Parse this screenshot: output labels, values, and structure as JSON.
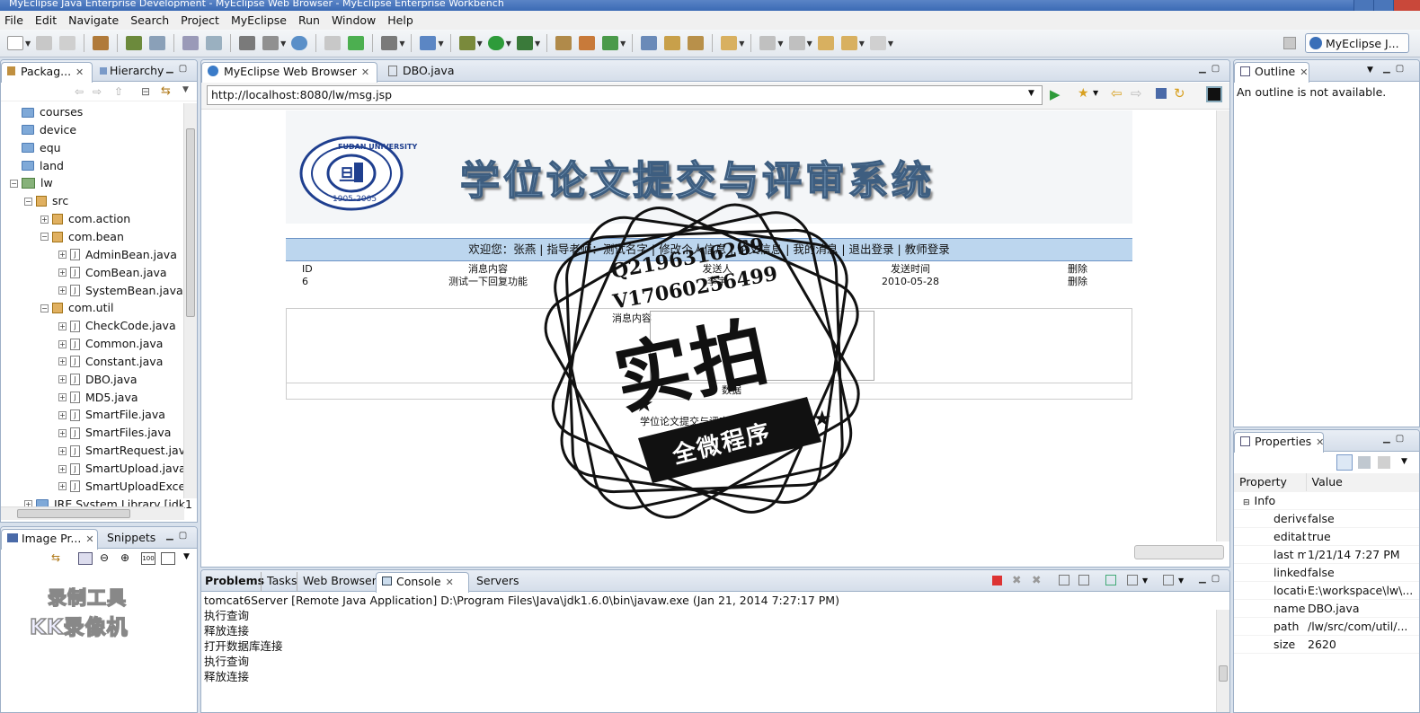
{
  "window": {
    "title": "MyEclipse Java Enterprise Development - MyEclipse Web Browser - MyEclipse Enterprise Workbench"
  },
  "menu": [
    "File",
    "Edit",
    "Navigate",
    "Search",
    "Project",
    "MyEclipse",
    "Run",
    "Window",
    "Help"
  ],
  "perspective": "MyEclipse J...",
  "explorer": {
    "tabs": [
      "Packag...",
      "Hierarchy"
    ],
    "items": [
      {
        "label": "courses",
        "type": "folder",
        "depth": 0
      },
      {
        "label": "device",
        "type": "folder",
        "depth": 0
      },
      {
        "label": "equ",
        "type": "folder",
        "depth": 0
      },
      {
        "label": "land",
        "type": "folder",
        "depth": 0
      },
      {
        "label": "lw",
        "type": "project",
        "depth": 0
      },
      {
        "label": "src",
        "type": "src",
        "depth": 1
      },
      {
        "label": "com.action",
        "type": "package",
        "depth": 2
      },
      {
        "label": "com.bean",
        "type": "package",
        "depth": 2
      },
      {
        "label": "AdminBean.java",
        "type": "java",
        "depth": 3
      },
      {
        "label": "ComBean.java",
        "type": "java",
        "depth": 3
      },
      {
        "label": "SystemBean.java",
        "type": "java",
        "depth": 3
      },
      {
        "label": "com.util",
        "type": "package",
        "depth": 2
      },
      {
        "label": "CheckCode.java",
        "type": "java",
        "depth": 3
      },
      {
        "label": "Common.java",
        "type": "java",
        "depth": 3
      },
      {
        "label": "Constant.java",
        "type": "java",
        "depth": 3
      },
      {
        "label": "DBO.java",
        "type": "java",
        "depth": 3
      },
      {
        "label": "MD5.java",
        "type": "java",
        "depth": 3
      },
      {
        "label": "SmartFile.java",
        "type": "java",
        "depth": 3
      },
      {
        "label": "SmartFiles.java",
        "type": "java",
        "depth": 3
      },
      {
        "label": "SmartRequest.java",
        "type": "java",
        "depth": 3
      },
      {
        "label": "SmartUpload.java",
        "type": "java",
        "depth": 3
      },
      {
        "label": "SmartUploadExce",
        "type": "java",
        "depth": 3
      },
      {
        "label": "JRE System Library [jdk1",
        "type": "lib",
        "depth": 1
      }
    ]
  },
  "image_panel": {
    "tabs": [
      "Image Pr...",
      "Snippets"
    ],
    "watermark_line1": "录制工具",
    "watermark_line2": "KK录像机"
  },
  "editor": {
    "tabs": [
      "MyEclipse Web Browser",
      "DBO.java"
    ],
    "url": "http://localhost:8080/lw/msg.jsp"
  },
  "page": {
    "logo_top": "FUDAN UNIVERSITY",
    "logo_years": "1905-2005",
    "system_title": "学位论文提交与评审系统",
    "nav": "欢迎您：张燕 | 指导老师：测试名字 | 修改个人信息 | 论文信息 | 我的消息 | 退出登录 | 教师登录",
    "table_headers": [
      "ID",
      "消息内容",
      "发送人",
      "发送时间",
      "删除"
    ],
    "rows": [
      [
        "6",
        "测试一下回复功能",
        "李宇",
        "2010-05-28",
        "删除"
      ]
    ],
    "reply_label": "消息内容",
    "footer_frag": "数据",
    "copyright": "学位论文提交与评审系统"
  },
  "seal": {
    "line1": "Q2196316269",
    "line2": "V17060256499",
    "big": "实拍",
    "banner": "全微程序"
  },
  "outline": {
    "tab": "Outline",
    "message": "An outline is not available."
  },
  "properties": {
    "tab": "Properties",
    "headers": [
      "Property",
      "Value"
    ],
    "group": "Info",
    "rows": [
      [
        "derive",
        "false"
      ],
      [
        "editab",
        "true"
      ],
      [
        "last m",
        "1/21/14 7:27 PM"
      ],
      [
        "linked",
        "false"
      ],
      [
        "locatic",
        "E:\\workspace\\lw\\..."
      ],
      [
        "name",
        "DBO.java"
      ],
      [
        "path",
        "/lw/src/com/util/..."
      ],
      [
        "size",
        "2620"
      ]
    ]
  },
  "console": {
    "tabs": [
      "Problems",
      "Tasks",
      "Web Browser",
      "Console",
      "Servers"
    ],
    "header": "tomcat6Server [Remote Java Application] D:\\Program Files\\Java\\jdk1.6.0\\bin\\javaw.exe (Jan 21, 2014 7:27:17 PM)",
    "lines": [
      "执行查询",
      "释放连接",
      "打开数据库连接",
      "执行查询",
      "释放连接"
    ]
  }
}
